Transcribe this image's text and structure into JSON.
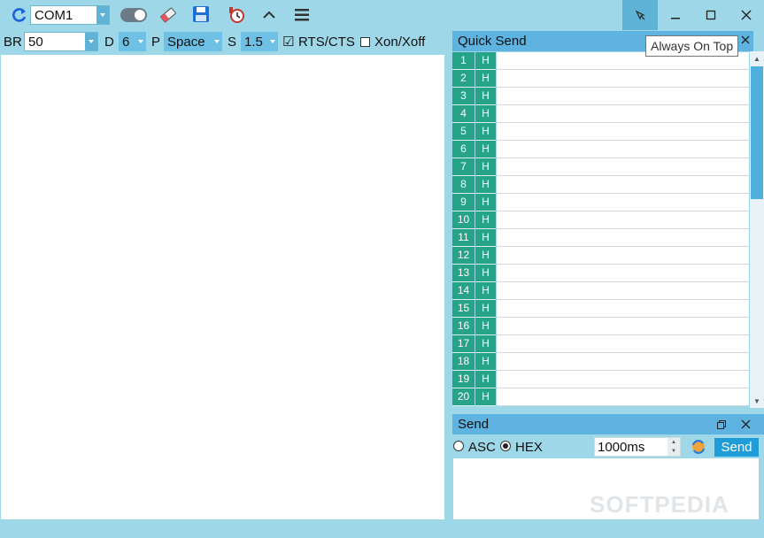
{
  "toolbar": {
    "port": "COM1",
    "refresh_icon": "refresh-icon",
    "toggle_icon": "toggle-icon",
    "eraser_icon": "eraser-icon",
    "save_icon": "save-icon",
    "timer_icon": "timer-icon",
    "collapse_icon": "chevron-up-icon",
    "menu_icon": "menu-icon"
  },
  "settings": {
    "br_label": "BR",
    "br_value": "50",
    "d_label": "D",
    "d_value": "6",
    "p_label": "P",
    "p_value": "Space",
    "s_label": "S",
    "s_value": "1.5",
    "rts_label": "RTS/CTS",
    "rts_checked": "☑",
    "xon_label": "Xon/Xoff"
  },
  "window": {
    "pin_icon": "pin-icon",
    "minimize_icon": "minimize-icon",
    "maximize_icon": "maximize-icon",
    "close_icon": "close-icon",
    "tooltip": "Always On Top"
  },
  "quick_send": {
    "title": "Quick Send",
    "rows": [
      {
        "num": "1",
        "h": "H"
      },
      {
        "num": "2",
        "h": "H"
      },
      {
        "num": "3",
        "h": "H"
      },
      {
        "num": "4",
        "h": "H"
      },
      {
        "num": "5",
        "h": "H"
      },
      {
        "num": "6",
        "h": "H"
      },
      {
        "num": "7",
        "h": "H"
      },
      {
        "num": "8",
        "h": "H"
      },
      {
        "num": "9",
        "h": "H"
      },
      {
        "num": "10",
        "h": "H"
      },
      {
        "num": "11",
        "h": "H"
      },
      {
        "num": "12",
        "h": "H"
      },
      {
        "num": "13",
        "h": "H"
      },
      {
        "num": "14",
        "h": "H"
      },
      {
        "num": "15",
        "h": "H"
      },
      {
        "num": "16",
        "h": "H"
      },
      {
        "num": "17",
        "h": "H"
      },
      {
        "num": "18",
        "h": "H"
      },
      {
        "num": "19",
        "h": "H"
      },
      {
        "num": "20",
        "h": "H"
      }
    ]
  },
  "send": {
    "title": "Send",
    "asc_label": "ASC",
    "hex_label": "HEX",
    "interval": "1000ms",
    "send_label": "Send"
  },
  "watermark": "SOFTPEDIA"
}
